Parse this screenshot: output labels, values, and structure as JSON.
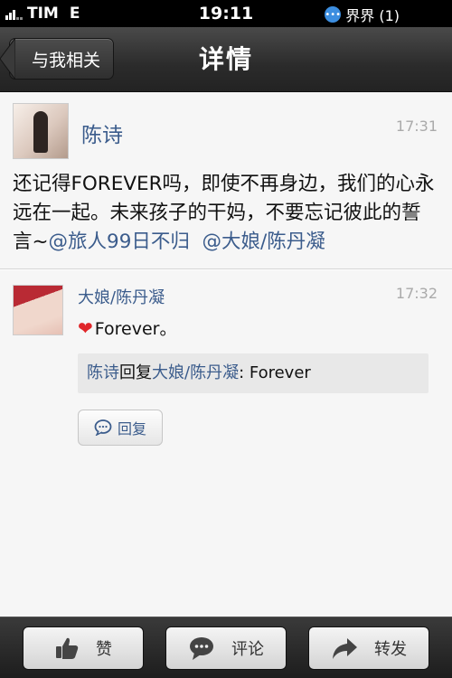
{
  "status_bar": {
    "carrier": "TIM",
    "network": "E",
    "time": "19:11",
    "notification": "界界 (1)"
  },
  "nav": {
    "back_label": "与我相关",
    "title": "详情"
  },
  "post": {
    "author": "陈诗",
    "time": "17:31",
    "text": "还记得FOREVER吗，即使不再身边，我们的心永远在一起。未来孩子的干妈，不要忘记彼此的誓言~",
    "mentions": [
      "@旅人99日不归",
      "@大娘/陈丹凝"
    ]
  },
  "comment": {
    "author": "大娘/陈丹凝",
    "time": "17:32",
    "text": "Forever。",
    "reply_from": "陈诗",
    "reply_verb": "回复",
    "reply_to": "大娘/陈丹凝",
    "reply_text": ": Forever",
    "reply_button": "回复"
  },
  "toolbar": {
    "like": "赞",
    "comment": "评论",
    "forward": "转发"
  },
  "colors": {
    "link": "#3b5c8c",
    "heart": "#e0262a"
  }
}
